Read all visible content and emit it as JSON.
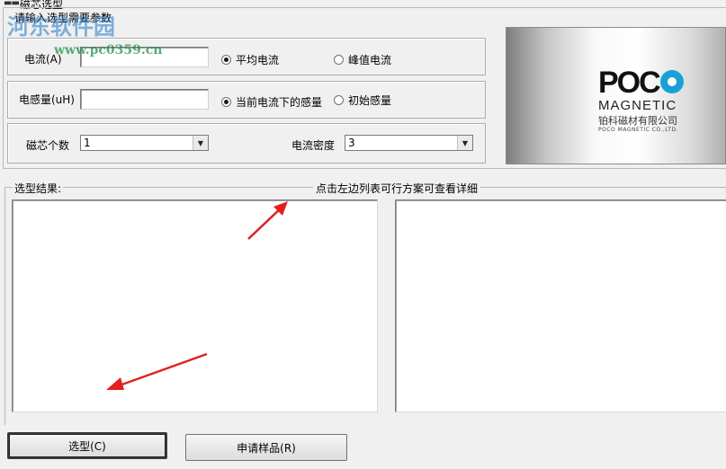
{
  "window": {
    "title": "磁芯选型"
  },
  "params_legend": "请输入选型需要参数",
  "current": {
    "label": "电流(A)",
    "value": "",
    "options": [
      "平均电流",
      "峰值电流"
    ],
    "selected": 0
  },
  "inductance": {
    "label": "电感量(uH)",
    "value": "",
    "options": [
      "当前电流下的感量",
      "初始感量"
    ],
    "selected": 0
  },
  "cores": {
    "label": "磁芯个数",
    "value": "1"
  },
  "density": {
    "label": "电流密度",
    "value": "3"
  },
  "logo": {
    "brand": "POCO",
    "sub": "MAGNETIC",
    "cn": "铂科磁材有限公司",
    "en": "POCO MAGNETIC CO.,LTD."
  },
  "results": {
    "label": "选型结果:",
    "hint": "点击左边列表可行方案可查看详细"
  },
  "buttons": {
    "select": "选型(C)",
    "sample": "申请样品(R)"
  },
  "watermark": {
    "site": "河东软件园",
    "url": "www.pc0359.cn"
  },
  "colors": {
    "logo_o": "#1aa0d8",
    "arrow": "#e02020"
  }
}
